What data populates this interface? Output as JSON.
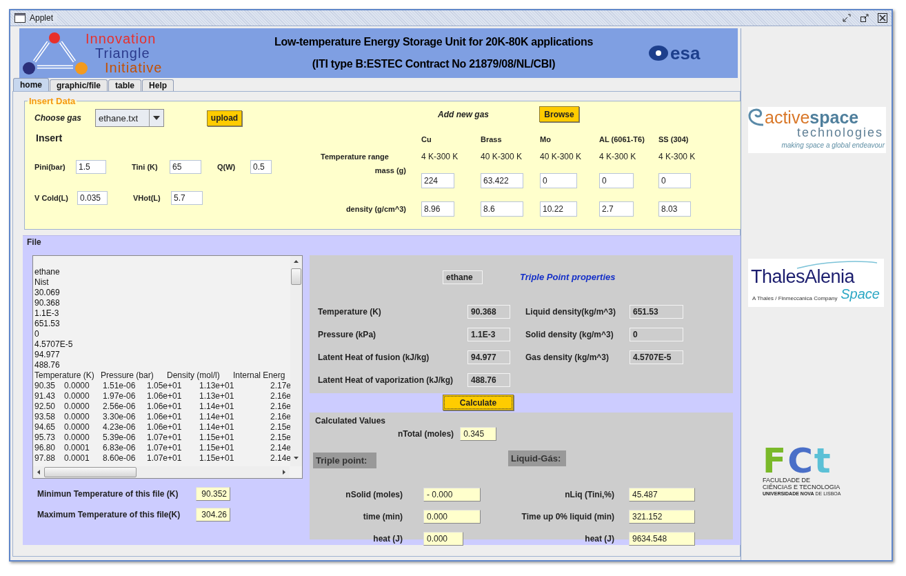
{
  "window": {
    "title": "Applet"
  },
  "header": {
    "logo_lines": [
      {
        "text": "Innovation",
        "color": "#e8302a"
      },
      {
        "text": "Triangle",
        "color": "#2b3a8c"
      },
      {
        "text": "Initiative",
        "color": "#c45000"
      }
    ],
    "title_lines": [
      "Low-temperature Energy Storage Unit for 20K-80K applications",
      "(ITI type B:ESTEC Contract No 21879/08/NL/CBI)"
    ],
    "agency_logo": "esa"
  },
  "tabs": [
    {
      "label": "home",
      "selected": true
    },
    {
      "label": "graphic/file",
      "selected": false
    },
    {
      "label": "table",
      "selected": false
    },
    {
      "label": "Help",
      "selected": false
    }
  ],
  "insert_data": {
    "legend": "Insert Data",
    "choose_gas_label": "Choose gas",
    "gas_select": "ethane.txt",
    "upload_button": "upload",
    "insert_heading": "Insert",
    "field_rows": [
      [
        {
          "label": "Pini(bar)",
          "value": "1.5"
        },
        {
          "label": "Tini  (K)",
          "value": "65"
        },
        {
          "label": "Q(W)",
          "value": "0.5"
        }
      ],
      [
        {
          "label": "V Cold(L)",
          "value": "0.035"
        },
        {
          "label": "VHot(L)",
          "value": "5.7"
        }
      ]
    ],
    "add_gas_label": "Add new  gas",
    "browse_button": "Browse",
    "row_labels": [
      "Temperature range",
      "mass (g)",
      "density (g/cm^3)"
    ],
    "materials": [
      {
        "name": "Cu",
        "range": "4 K-300 K",
        "mass": "224",
        "density": "8.96"
      },
      {
        "name": "Brass",
        "range": "40 K-300 K",
        "mass": "63.422",
        "density": "8.6"
      },
      {
        "name": "Mo",
        "range": "40 K-300 K",
        "mass": "0",
        "density": "10.22"
      },
      {
        "name": "AL (6061-T6)",
        "range": "4 K-300 K",
        "mass": "0",
        "density": "2.7"
      },
      {
        "name": "SS (304)",
        "range": "4 K-300 K",
        "mass": "0",
        "density": "8.03"
      }
    ]
  },
  "file": {
    "title": "File",
    "text_lines": [
      "ethane",
      "Nist",
      "30.069",
      "90.368",
      "1.1E-3",
      "651.53",
      "0",
      "4.5707E-5",
      "94.977",
      "488.76"
    ],
    "table_header": [
      "Temperature (K)",
      "Pressure (bar)",
      "Density (mol/l)",
      "Internal Energ"
    ],
    "table_rows": [
      [
        "90.35",
        "0.0000",
        "1.51e-06",
        "1.05e+01",
        "1.13e+01",
        "2.17e"
      ],
      [
        "91.43",
        "0.0000",
        "1.97e-06",
        "1.06e+01",
        "1.13e+01",
        "2.16e"
      ],
      [
        "92.50",
        "0.0000",
        "2.56e-06",
        "1.06e+01",
        "1.14e+01",
        "2.16e"
      ],
      [
        "93.58",
        "0.0000",
        "3.30e-06",
        "1.06e+01",
        "1.14e+01",
        "2.16e"
      ],
      [
        "94.65",
        "0.0000",
        "4.23e-06",
        "1.06e+01",
        "1.14e+01",
        "2.15e"
      ],
      [
        "95.73",
        "0.0000",
        "5.39e-06",
        "1.07e+01",
        "1.15e+01",
        "2.15e"
      ],
      [
        "96.80",
        "0.0001",
        "6.83e-06",
        "1.07e+01",
        "1.15e+01",
        "2.14e"
      ],
      [
        "97.88",
        "0.0001",
        "8.60e-06",
        "1.07e+01",
        "1.15e+01",
        "2.14e"
      ]
    ],
    "limits": [
      {
        "label": "Minimun Temperature of this file (K)",
        "value": "90.352"
      },
      {
        "label": "Maximum Temperature of this file(K)",
        "value": "304.26"
      }
    ]
  },
  "triple_point": {
    "gas": "ethane",
    "title": "Triple Point properties",
    "rows": [
      {
        "label": "Temperature (K)",
        "value": "90.368",
        "label_2": "Liquid density(kg/m^3)",
        "value_2": "651.53"
      },
      {
        "label": "Pressure (kPa)",
        "value": "1.1E-3",
        "label_2": "Solid density (kg/m^3)",
        "value_2": "0"
      },
      {
        "label": "Latent Heat of fusion (kJ/kg)",
        "value": "94.977",
        "label_2": "Gas density (kg/m^3)",
        "value_2": "4.5707E-5"
      },
      {
        "label": "Latent Heat of vaporization (kJ/kg)",
        "value": "488.76"
      }
    ]
  },
  "calculate_button": "Calculate",
  "calculated": {
    "title": "Calculated Values",
    "total_label": "nTotal (moles)",
    "total_value": "0.345",
    "triple_heading": "Triple point:",
    "liquid_heading": "Liquid-Gás:",
    "triple_rows": [
      {
        "label": "nSolid (moles)",
        "value": "- 0.000"
      },
      {
        "label": "time (min)",
        "value": "0.000"
      },
      {
        "label": "heat (J)",
        "value": "0.000"
      }
    ],
    "liquid_rows": [
      {
        "label": "nLiq (Tini,%)",
        "value": "45.487"
      },
      {
        "label": "Time up 0% liquid (min)",
        "value": "321.152"
      },
      {
        "label": "heat (J)",
        "value": "9634.548"
      }
    ]
  },
  "partners": [
    {
      "kind": "activespace",
      "name_parts": [
        "active",
        "space"
      ],
      "subtitle": "technologies",
      "tagline": "making space a global endeavour"
    },
    {
      "kind": "thales",
      "name": "ThalesAlenia",
      "tagline": "A Thales / Finmeccanica Company",
      "subtitle": "Space"
    },
    {
      "kind": "fct",
      "letters": [
        {
          "text": "F",
          "color": "#7ab929"
        },
        {
          "text": "C",
          "color": "#4a6fc8"
        },
        {
          "text": "t",
          "color": "#5bc0d6"
        }
      ],
      "lines": [
        "FACULDADE DE",
        "CIÊNCIAS E TECNOLOGIA",
        "**UNIVERSIDADE NOVA** DE LISBOA"
      ]
    }
  ]
}
